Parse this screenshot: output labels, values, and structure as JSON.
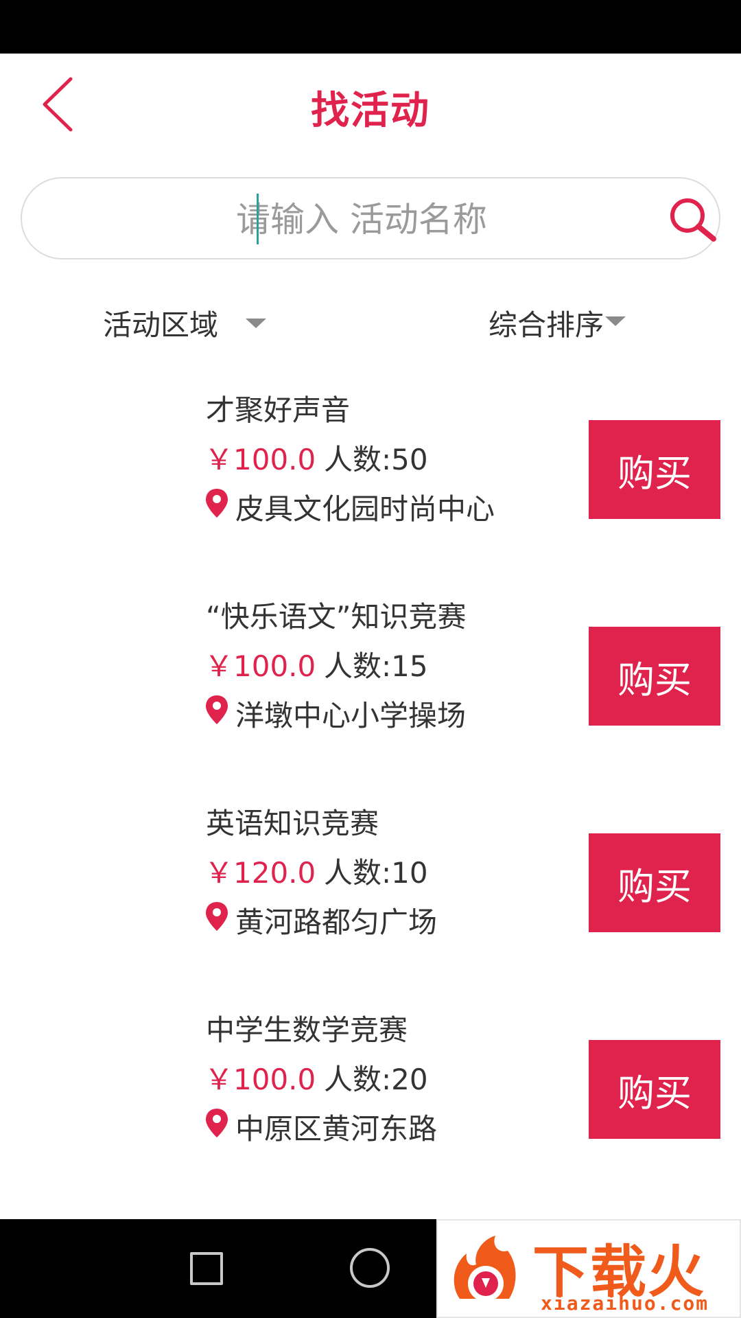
{
  "header": {
    "title": "找活动",
    "title_color": "#e0234d",
    "back_icon": "chevron-left-icon"
  },
  "search": {
    "placeholder": "请输入 活动名称",
    "value": "",
    "icon": "search-icon"
  },
  "filters": {
    "area_label": "活动区域",
    "sort_label": "综合排序"
  },
  "activities": [
    {
      "title": "才聚好声音",
      "price": "￥100.0",
      "count": "人数:50",
      "location": "皮具文化园时尚中心",
      "buy_label": "购买"
    },
    {
      "title": "“快乐语文”知识竞赛",
      "price": "￥100.0",
      "count": "人数:15",
      "location": "洋墩中心小学操场",
      "buy_label": "购买"
    },
    {
      "title": "英语知识竞赛",
      "price": "￥120.0",
      "count": "人数:10",
      "location": "黄河路都匀广场",
      "buy_label": "购买"
    },
    {
      "title": "中学生数学竞赛",
      "price": "￥100.0",
      "count": "人数:20",
      "location": "中原区黄河东路",
      "buy_label": "购买"
    }
  ],
  "colors": {
    "accent": "#e0234d",
    "text": "#333333",
    "muted": "#9a9a9a"
  },
  "watermark": {
    "title": "下载火",
    "url": "xiazaihuo.com"
  }
}
